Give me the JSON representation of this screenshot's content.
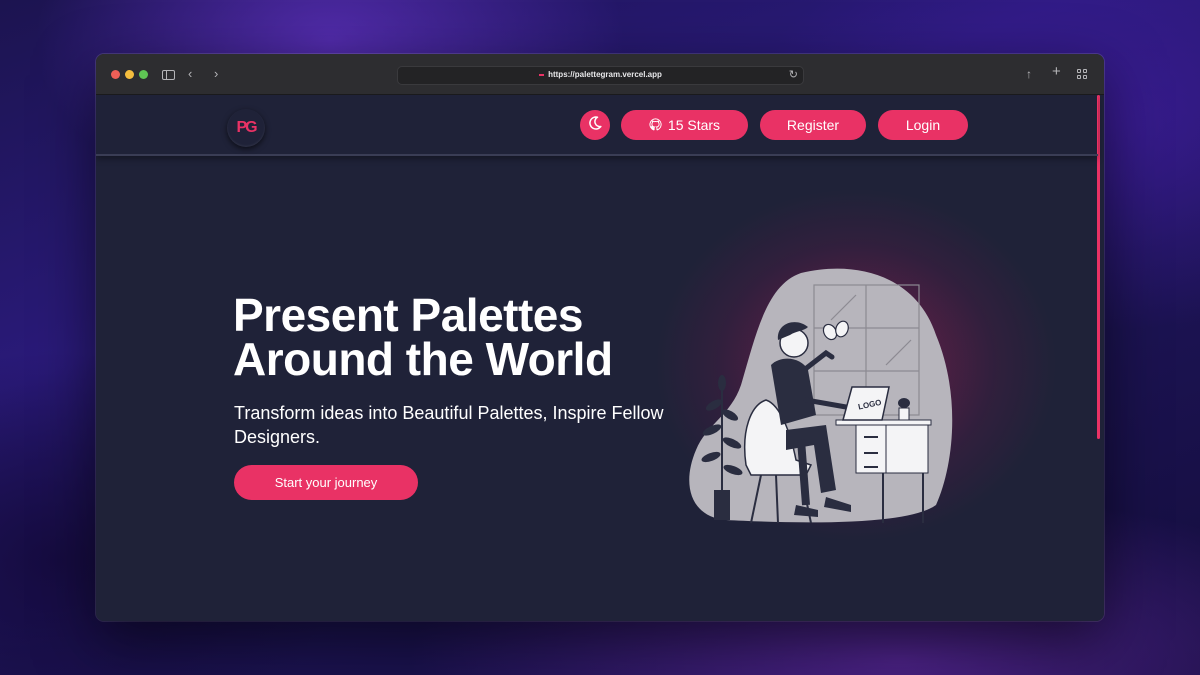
{
  "browser": {
    "url": "https://palettegram.vercel.app"
  },
  "nav": {
    "logo_text": "PG",
    "stars_label": "15 Stars",
    "register_label": "Register",
    "login_label": "Login"
  },
  "hero": {
    "title_line1": "Present Palettes",
    "title_line2": "Around the World",
    "subtitle": "Transform ideas into Beautiful Palettes, Inspire Fellow Designers.",
    "cta_label": "Start your journey",
    "illustration_logo_text": "LOGO"
  },
  "colors": {
    "accent": "#e93265",
    "page_background": "#1f2238",
    "browser_chrome": "#2d2d30"
  },
  "icons": [
    "sidebar-icon",
    "back-icon",
    "forward-icon",
    "reload-icon",
    "share-icon",
    "new-tab-icon",
    "tab-overview-icon",
    "moon-icon",
    "github-icon"
  ]
}
